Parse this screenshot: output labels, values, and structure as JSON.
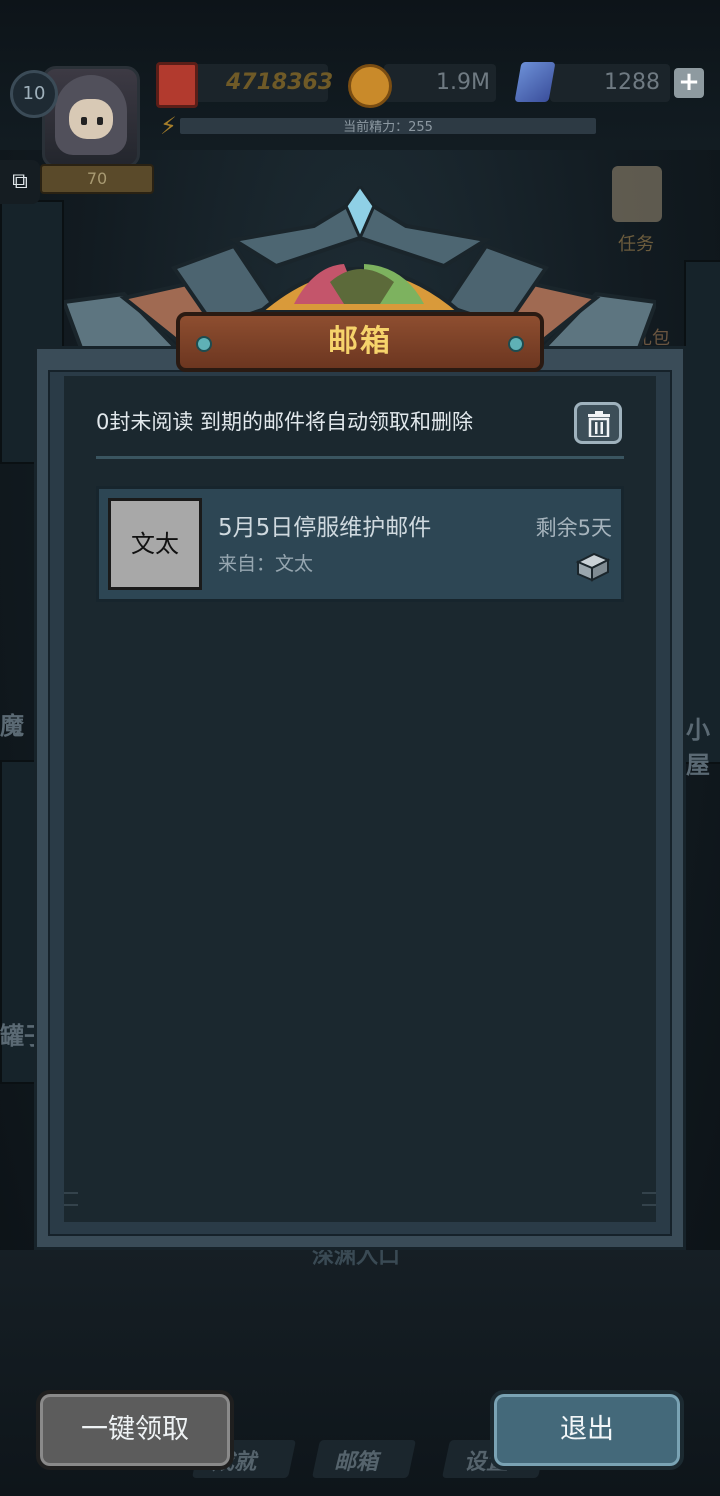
{
  "hud": {
    "level": "10",
    "rank_level": "70",
    "tickets": "4718363",
    "gold": "1.9M",
    "gems": "1288",
    "energy_label": "当前精力：255",
    "energy_fraction": 1.0
  },
  "side": {
    "task_label": "任务",
    "gift_label": "限礼包",
    "left_text_1": "魔",
    "left_text_2": "罐子",
    "right_text_1": "小屋"
  },
  "mailbox": {
    "title": "邮箱",
    "unread_text": "0封未阅读  到期的邮件将自动领取和删除",
    "mails": [
      {
        "avatar_text": "文太",
        "title": "5月5日停服维护邮件",
        "from": "来自：文太",
        "remaining": "剩余5天"
      }
    ]
  },
  "background": {
    "deep_label": "深渊入口"
  },
  "bottom": {
    "claim_all_label": "一键领取",
    "exit_label": "退出",
    "nav_achievement": "成就",
    "nav_mailbox": "邮箱",
    "nav_settings": "设置"
  },
  "colors": {
    "title_text": "#f6d36b",
    "panel_bg": "#1b282f",
    "mail_item_bg": "#2d4654",
    "exit_button": "#44697a",
    "claim_button": "#5c5c5c"
  },
  "icons": [
    "level-badge-icon",
    "ticket-icon",
    "coin-icon",
    "gem-icon",
    "plus-icon",
    "energy-icon",
    "puzzle-icon",
    "task-scroll-icon",
    "trash-icon",
    "attachment-box-icon"
  ]
}
